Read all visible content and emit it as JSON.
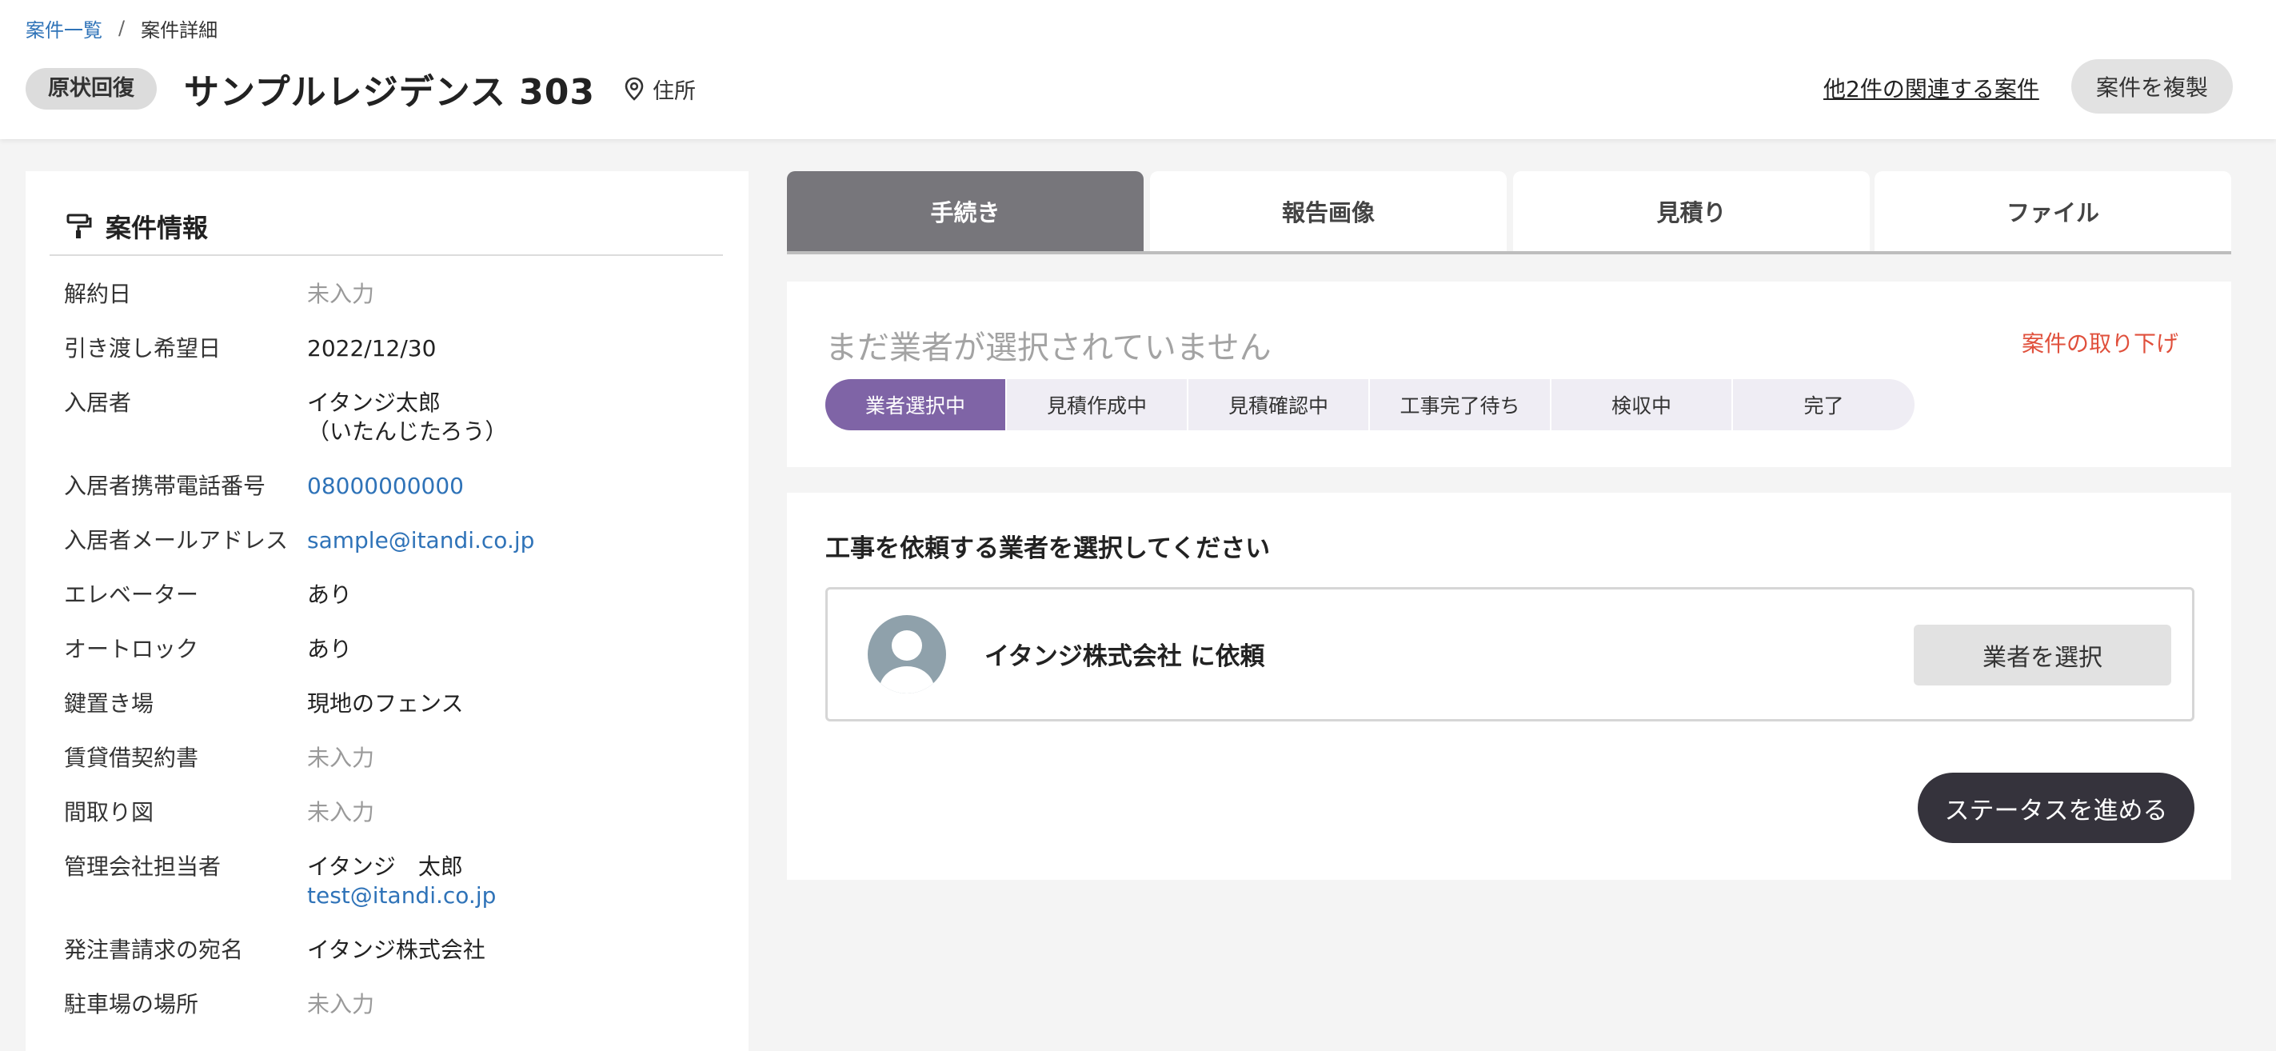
{
  "breadcrumb": {
    "parent": "案件一覧",
    "separator": "/",
    "current": "案件詳細"
  },
  "header": {
    "type_badge": "原状回復",
    "title": "サンプルレジデンス 303",
    "address_label": "住所",
    "related_link": "他2件の関連する案件",
    "duplicate_button": "案件を複製"
  },
  "info_panel": {
    "title": "案件情報",
    "rows": [
      {
        "label": "解約日",
        "value": "未入力"
      },
      {
        "label": "引き渡し希望日",
        "value": "2022/12/30"
      },
      {
        "label": "入居者",
        "value": "イタンジ太郎",
        "value2": "（いたんじたろう）"
      },
      {
        "label": "入居者携帯電話番号",
        "value": "08000000000"
      },
      {
        "label": "入居者メールアドレス",
        "value": "sample@itandi.co.jp"
      },
      {
        "label": "エレベーター",
        "value": "あり"
      },
      {
        "label": "オートロック",
        "value": "あり"
      },
      {
        "label": "鍵置き場",
        "value": "現地のフェンス"
      },
      {
        "label": "賃貸借契約書",
        "value": "未入力"
      },
      {
        "label": "間取り図",
        "value": "未入力"
      },
      {
        "label": "管理会社担当者",
        "value": "イタンジ　太郎",
        "value2": "test@itandi.co.jp"
      },
      {
        "label": "発注書請求の宛名",
        "value": "イタンジ株式会社"
      },
      {
        "label": "駐車場の場所",
        "value": "未入力"
      }
    ]
  },
  "tabs": [
    {
      "label": "手続き",
      "active": true
    },
    {
      "label": "報告画像",
      "active": false
    },
    {
      "label": "見積り",
      "active": false
    },
    {
      "label": "ファイル",
      "active": false
    }
  ],
  "status": {
    "message": "まだ業者が選択されていません",
    "withdraw_link": "案件の取り下げ",
    "steps": [
      "業者選択中",
      "見積作成中",
      "見積確認中",
      "工事完了待ち",
      "検収中",
      "完了"
    ],
    "active_step": 0
  },
  "vendor": {
    "heading": "工事を依頼する業者を選択してください",
    "name": "イタンジ株式会社 に依頼",
    "select_button": "業者を選択",
    "advance_button": "ステータスを進める"
  },
  "colors": {
    "link": "#2f73b8",
    "active_tab": "#77767b",
    "active_step": "#7f64a6",
    "step_bg": "#efedf4",
    "withdraw": "#e0503c",
    "advance_button": "#35333c"
  },
  "icons": {
    "address": "location-pin-icon",
    "panel": "paint-roller-icon",
    "avatar": "person-avatar-icon"
  }
}
